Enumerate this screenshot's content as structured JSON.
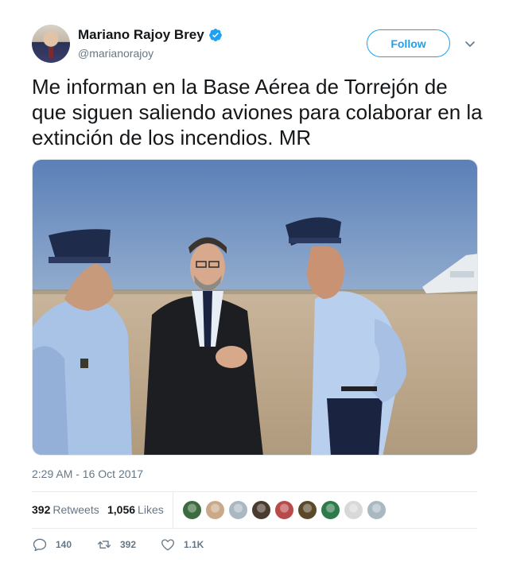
{
  "author": {
    "display_name": "Mariano Rajoy Brey",
    "handle": "@marianorajoy",
    "verified": true,
    "verified_color": "#1da1f2"
  },
  "follow_label": "Follow",
  "tweet_text": "Me informan en la Base Aérea de Torrejón de que siguen saliendo aviones para colaborar en la extinción de los incendios. MR",
  "timestamp": "2:29 AM - 16 Oct 2017",
  "stats": {
    "retweets_count": "392",
    "retweets_label": "Retweets",
    "likes_count": "1,056",
    "likes_label": "Likes"
  },
  "actions": {
    "replies": "140",
    "retweets": "392",
    "likes": "1.1K"
  },
  "colors": {
    "accent": "#1da1f2",
    "muted_text": "#657786",
    "divider": "#e6ecf0"
  },
  "liker_avatar_colors": [
    "#3c6b3f",
    "#c9a98a",
    "#aab8c2",
    "#4a3b30",
    "#b84a4a",
    "#5b4a2a",
    "#2f7a4b",
    "#d8d8d8",
    "#aab8c2"
  ]
}
